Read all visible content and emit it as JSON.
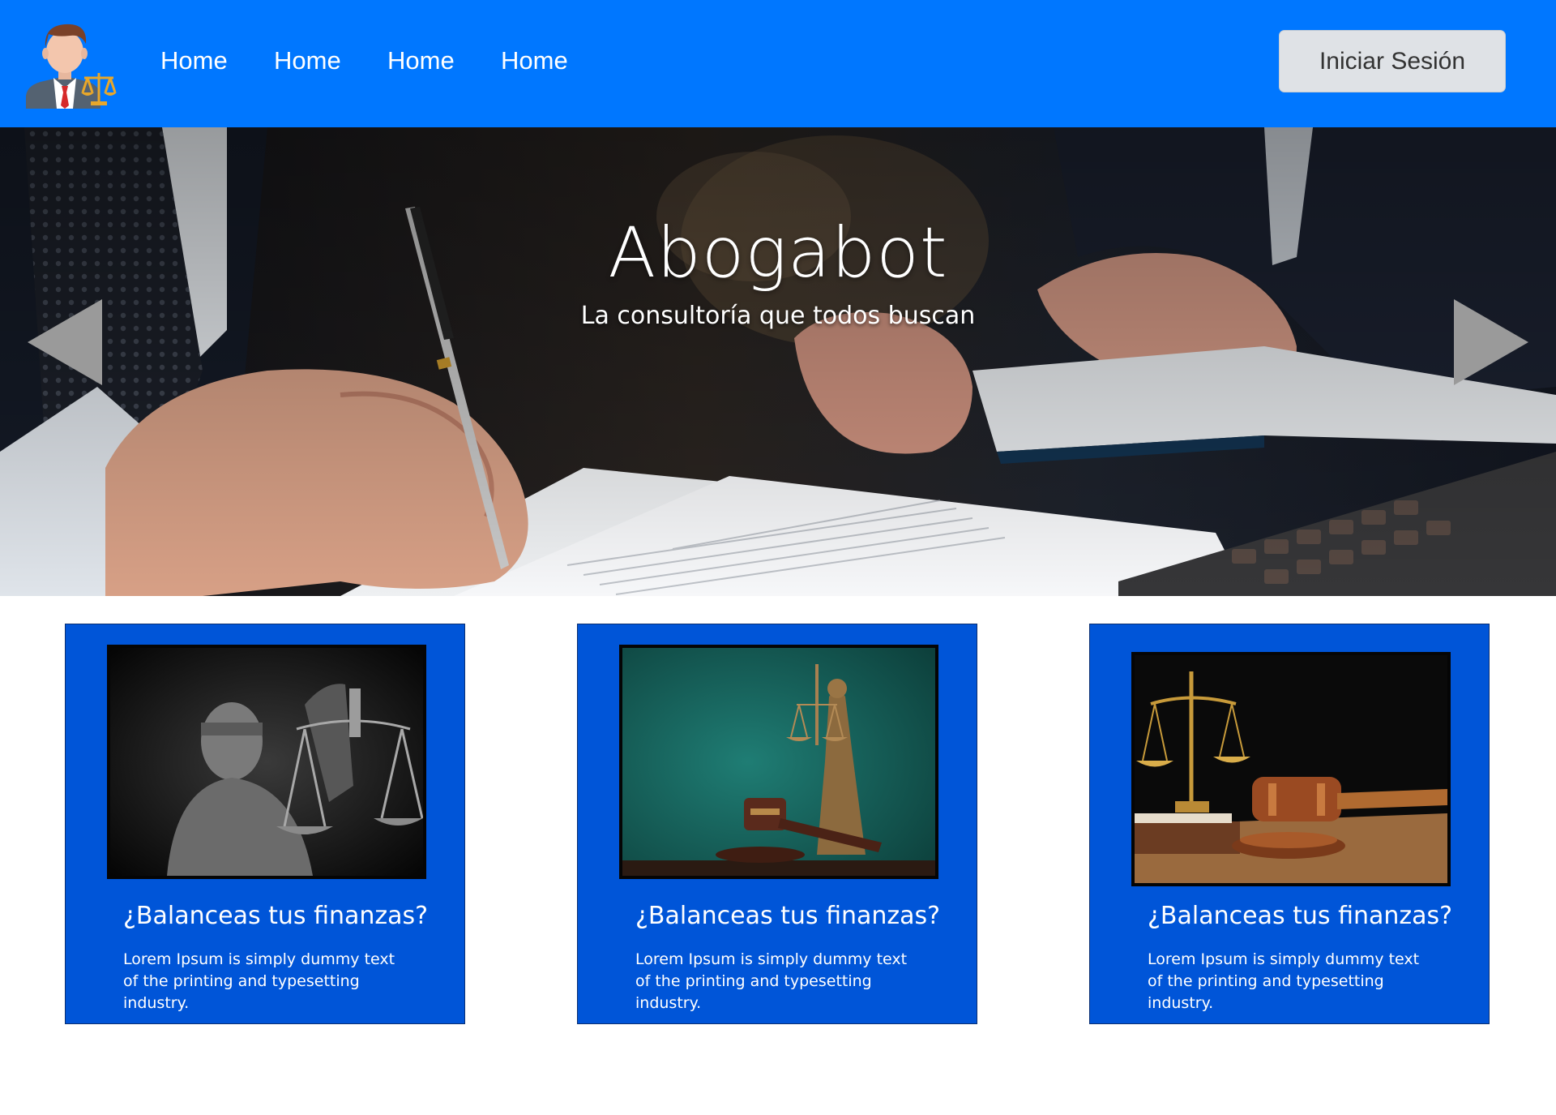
{
  "header": {
    "logo": "lawyer-logo-icon",
    "nav": [
      {
        "label": "Home"
      },
      {
        "label": "Home"
      },
      {
        "label": "Home"
      },
      {
        "label": "Home"
      }
    ],
    "login_label": "Iniciar Sesión"
  },
  "hero": {
    "title": "Abogabot",
    "subtitle": "La consultoría que todos buscan",
    "prev_icon": "triangle-left-icon",
    "next_icon": "triangle-right-icon"
  },
  "cards": [
    {
      "title": "¿Balanceas tus finanzas?",
      "text": "Lorem Ipsum is simply dummy text of the printing and typesetting industry.",
      "image": "lady-justice-scales-photo"
    },
    {
      "title": "¿Balanceas tus finanzas?",
      "text": "Lorem Ipsum is simply dummy text of the printing and typesetting industry.",
      "image": "justice-statue-gavel-photo"
    },
    {
      "title": "¿Balanceas tus finanzas?",
      "text": "Lorem Ipsum is simply dummy text of the printing and typesetting industry.",
      "image": "scales-gavel-books-photo"
    }
  ],
  "colors": {
    "header_bg": "#0077ff",
    "card_bg": "#0055d8",
    "button_bg": "#dfe2e6",
    "arrow": "#9a9a9a"
  }
}
